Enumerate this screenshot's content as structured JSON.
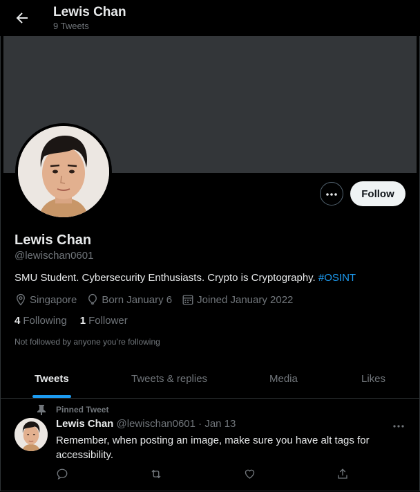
{
  "header": {
    "title": "Lewis Chan",
    "subtitle": "9 Tweets"
  },
  "profile": {
    "name": "Lewis Chan",
    "handle": "@lewischan0601",
    "bio_text": "SMU Student. Cybersecurity Enthusiasts. Crypto is Cryptography. ",
    "bio_hashtag": "#OSINT",
    "location": "Singapore",
    "birthday": "Born January 6",
    "joined": "Joined January 2022",
    "following_count": "4",
    "following_label": "Following",
    "followers_count": "1",
    "followers_label": "Follower",
    "not_followed_note": "Not followed by anyone you’re following",
    "follow_label": "Follow"
  },
  "tabs": [
    {
      "label": "Tweets",
      "active": true
    },
    {
      "label": "Tweets & replies",
      "active": false
    },
    {
      "label": "Media",
      "active": false
    },
    {
      "label": "Likes",
      "active": false
    }
  ],
  "pinned_tweet": {
    "pinned_label": "Pinned Tweet",
    "author_name": "Lewis Chan",
    "author_handle": "@lewischan0601",
    "separator": " · ",
    "date": "Jan 13",
    "text": "Remember, when posting an image, make sure you have alt tags for accessibility."
  },
  "icons": {
    "back": "arrow-left-icon",
    "more": "ellipsis-icon",
    "location": "location-pin-icon",
    "birthday": "balloon-icon",
    "joined": "calendar-icon",
    "pin": "pin-icon",
    "reply": "reply-icon",
    "retweet": "retweet-icon",
    "like": "heart-icon",
    "share": "share-icon"
  },
  "colors": {
    "background": "#000000",
    "banner": "#333639",
    "accent": "#1d9bf0",
    "muted_text": "#71767b",
    "primary_text": "#e7e9ea",
    "follow_button": "#eff3f4"
  }
}
